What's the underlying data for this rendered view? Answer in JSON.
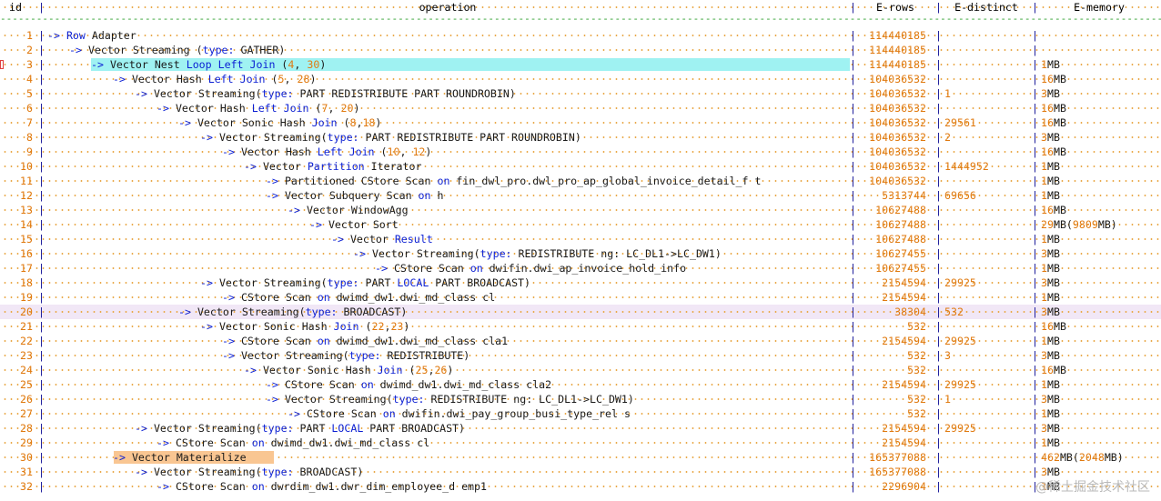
{
  "columns": {
    "id": "id",
    "operation": "operation",
    "rows": "E-rows",
    "distinct": "E-distinct",
    "memory": "E-memory"
  },
  "rows": [
    {
      "id": "1",
      "indent": 0,
      "parts": [
        [
          "arrow",
          "-> "
        ],
        [
          "kw",
          "Row"
        ],
        [
          "txt",
          " Adapter"
        ]
      ],
      "rows": "114440185",
      "distinct": "",
      "memory": []
    },
    {
      "id": "2",
      "indent": 1,
      "parts": [
        [
          "arrow",
          "-> "
        ],
        [
          "txt",
          "Vector Streaming "
        ],
        [
          "txt",
          "("
        ],
        [
          "kw",
          "type:"
        ],
        [
          "txt",
          " GATHER)"
        ]
      ],
      "rows": "114440185",
      "distinct": "",
      "memory": []
    },
    {
      "id": "3",
      "indent": 2,
      "parts": [
        [
          "arrow",
          "-> "
        ],
        [
          "txt",
          "Vector Nest "
        ],
        [
          "kw",
          "Loop Left Join"
        ],
        [
          "txt",
          " ("
        ],
        [
          "num",
          "4"
        ],
        [
          "txt",
          ", "
        ],
        [
          "num",
          "30"
        ],
        [
          "txt",
          ")"
        ]
      ],
      "rows": "114440185",
      "distinct": "",
      "memory": [
        [
          "num",
          "1"
        ],
        [
          "txt",
          "MB"
        ]
      ]
    },
    {
      "id": "4",
      "indent": 3,
      "parts": [
        [
          "arrow",
          "-> "
        ],
        [
          "txt",
          "Vector Hash "
        ],
        [
          "kw",
          "Left Join"
        ],
        [
          "txt",
          " ("
        ],
        [
          "num",
          "5"
        ],
        [
          "txt",
          ", "
        ],
        [
          "num",
          "28"
        ],
        [
          "txt",
          ")"
        ]
      ],
      "rows": "104036532",
      "distinct": "",
      "memory": [
        [
          "num",
          "16"
        ],
        [
          "txt",
          "MB"
        ]
      ]
    },
    {
      "id": "5",
      "indent": 4,
      "parts": [
        [
          "arrow",
          "-> "
        ],
        [
          "txt",
          "Vector Streaming("
        ],
        [
          "kw",
          "type:"
        ],
        [
          "txt",
          " PART REDISTRIBUTE PART ROUNDROBIN)"
        ]
      ],
      "rows": "104036532",
      "distinct": "1",
      "memory": [
        [
          "num",
          "3"
        ],
        [
          "txt",
          "MB"
        ]
      ]
    },
    {
      "id": "6",
      "indent": 5,
      "parts": [
        [
          "arrow",
          "-> "
        ],
        [
          "txt",
          "Vector Hash "
        ],
        [
          "kw",
          "Left Join"
        ],
        [
          "txt",
          " ("
        ],
        [
          "num",
          "7"
        ],
        [
          "txt",
          ", "
        ],
        [
          "num",
          "20"
        ],
        [
          "txt",
          ")"
        ]
      ],
      "rows": "104036532",
      "distinct": "",
      "memory": [
        [
          "num",
          "16"
        ],
        [
          "txt",
          "MB"
        ]
      ]
    },
    {
      "id": "7",
      "indent": 6,
      "parts": [
        [
          "arrow",
          "-> "
        ],
        [
          "txt",
          "Vector Sonic Hash "
        ],
        [
          "kw",
          "Join"
        ],
        [
          "txt",
          " ("
        ],
        [
          "num",
          "8"
        ],
        [
          "txt",
          ","
        ],
        [
          "num",
          "18"
        ],
        [
          "txt",
          ")"
        ]
      ],
      "rows": "104036532",
      "distinct": "29561",
      "memory": [
        [
          "num",
          "16"
        ],
        [
          "txt",
          "MB"
        ]
      ]
    },
    {
      "id": "8",
      "indent": 7,
      "parts": [
        [
          "arrow",
          "-> "
        ],
        [
          "txt",
          "Vector Streaming("
        ],
        [
          "kw",
          "type:"
        ],
        [
          "txt",
          " PART REDISTRIBUTE PART ROUNDROBIN)"
        ]
      ],
      "rows": "104036532",
      "distinct": "2",
      "memory": [
        [
          "num",
          "3"
        ],
        [
          "txt",
          "MB"
        ]
      ]
    },
    {
      "id": "9",
      "indent": 8,
      "parts": [
        [
          "arrow",
          "-> "
        ],
        [
          "txt",
          "Vector Hash "
        ],
        [
          "kw",
          "Left Join"
        ],
        [
          "txt",
          " ("
        ],
        [
          "num",
          "10"
        ],
        [
          "txt",
          ", "
        ],
        [
          "num",
          "12"
        ],
        [
          "txt",
          ")"
        ]
      ],
      "rows": "104036532",
      "distinct": "",
      "memory": [
        [
          "num",
          "16"
        ],
        [
          "txt",
          "MB"
        ]
      ]
    },
    {
      "id": "10",
      "indent": 9,
      "parts": [
        [
          "arrow",
          "-> "
        ],
        [
          "txt",
          "Vector "
        ],
        [
          "kw",
          "Partition"
        ],
        [
          "txt",
          " Iterator"
        ]
      ],
      "rows": "104036532",
      "distinct": "1444952",
      "memory": [
        [
          "num",
          "1"
        ],
        [
          "txt",
          "MB"
        ]
      ]
    },
    {
      "id": "11",
      "indent": 10,
      "parts": [
        [
          "arrow",
          "-> "
        ],
        [
          "txt",
          "Partitioned CStore Scan "
        ],
        [
          "kw",
          "on"
        ],
        [
          "txt",
          " fin_dwl_pro.dwl_pro_ap_global_invoice_detail_f t"
        ]
      ],
      "rows": "104036532",
      "distinct": "",
      "memory": [
        [
          "num",
          "1"
        ],
        [
          "txt",
          "MB"
        ]
      ]
    },
    {
      "id": "12",
      "indent": 10,
      "parts": [
        [
          "arrow",
          "-> "
        ],
        [
          "txt",
          "Vector Subquery Scan "
        ],
        [
          "kw",
          "on"
        ],
        [
          "txt",
          " h"
        ]
      ],
      "rows": "5313744",
      "distinct": "69656",
      "memory": [
        [
          "num",
          "1"
        ],
        [
          "txt",
          "MB"
        ]
      ]
    },
    {
      "id": "13",
      "indent": 11,
      "parts": [
        [
          "arrow",
          "-> "
        ],
        [
          "txt",
          "Vector WindowAgg"
        ]
      ],
      "rows": "10627488",
      "distinct": "",
      "memory": [
        [
          "num",
          "16"
        ],
        [
          "txt",
          "MB"
        ]
      ]
    },
    {
      "id": "14",
      "indent": 12,
      "parts": [
        [
          "arrow",
          "-> "
        ],
        [
          "txt",
          "Vector Sort"
        ]
      ],
      "rows": "10627488",
      "distinct": "",
      "memory": [
        [
          "num",
          "29"
        ],
        [
          "txt",
          "MB("
        ],
        [
          "num",
          "9809"
        ],
        [
          "txt",
          "MB)"
        ]
      ]
    },
    {
      "id": "15",
      "indent": 13,
      "parts": [
        [
          "arrow",
          "-> "
        ],
        [
          "txt",
          "Vector "
        ],
        [
          "kw",
          "Result"
        ]
      ],
      "rows": "10627488",
      "distinct": "",
      "memory": [
        [
          "num",
          "1"
        ],
        [
          "txt",
          "MB"
        ]
      ]
    },
    {
      "id": "16",
      "indent": 14,
      "parts": [
        [
          "arrow",
          "-> "
        ],
        [
          "txt",
          "Vector Streaming("
        ],
        [
          "kw",
          "type:"
        ],
        [
          "txt",
          " REDISTRIBUTE ng: LC_DL1->LC_DW1)"
        ]
      ],
      "rows": "10627455",
      "distinct": "",
      "memory": [
        [
          "num",
          "3"
        ],
        [
          "txt",
          "MB"
        ]
      ]
    },
    {
      "id": "17",
      "indent": 15,
      "parts": [
        [
          "arrow",
          "-> "
        ],
        [
          "txt",
          "CStore Scan "
        ],
        [
          "kw",
          "on"
        ],
        [
          "txt",
          " dwifin.dwi_ap_invoice_hold_info"
        ]
      ],
      "rows": "10627455",
      "distinct": "",
      "memory": [
        [
          "num",
          "1"
        ],
        [
          "txt",
          "MB"
        ]
      ]
    },
    {
      "id": "18",
      "indent": 7,
      "parts": [
        [
          "arrow",
          "-> "
        ],
        [
          "txt",
          "Vector Streaming("
        ],
        [
          "kw",
          "type:"
        ],
        [
          "txt",
          " PART "
        ],
        [
          "kw",
          "LOCAL"
        ],
        [
          "txt",
          " PART BROADCAST)"
        ]
      ],
      "rows": "2154594",
      "distinct": "29925",
      "memory": [
        [
          "num",
          "3"
        ],
        [
          "txt",
          "MB"
        ]
      ]
    },
    {
      "id": "19",
      "indent": 8,
      "parts": [
        [
          "arrow",
          "-> "
        ],
        [
          "txt",
          "CStore Scan "
        ],
        [
          "kw",
          "on"
        ],
        [
          "txt",
          " dwimd_dw1.dwi_md_class cl"
        ]
      ],
      "rows": "2154594",
      "distinct": "",
      "memory": [
        [
          "num",
          "1"
        ],
        [
          "txt",
          "MB"
        ]
      ]
    },
    {
      "id": "20",
      "indent": 6,
      "parts": [
        [
          "arrow",
          "-> "
        ],
        [
          "txt",
          "Vector Streaming("
        ],
        [
          "kw",
          "type:"
        ],
        [
          "txt",
          " BROADCAST)"
        ]
      ],
      "rows": "38304",
      "distinct": "532",
      "memory": [
        [
          "num",
          "3"
        ],
        [
          "txt",
          "MB"
        ]
      ]
    },
    {
      "id": "21",
      "indent": 7,
      "parts": [
        [
          "arrow",
          "-> "
        ],
        [
          "txt",
          "Vector Sonic Hash "
        ],
        [
          "kw",
          "Join"
        ],
        [
          "txt",
          " ("
        ],
        [
          "num",
          "22"
        ],
        [
          "txt",
          ","
        ],
        [
          "num",
          "23"
        ],
        [
          "txt",
          ")"
        ]
      ],
      "rows": "532",
      "distinct": "",
      "memory": [
        [
          "num",
          "16"
        ],
        [
          "txt",
          "MB"
        ]
      ]
    },
    {
      "id": "22",
      "indent": 8,
      "parts": [
        [
          "arrow",
          "-> "
        ],
        [
          "txt",
          "CStore Scan "
        ],
        [
          "kw",
          "on"
        ],
        [
          "txt",
          " dwimd_dw1.dwi_md_class cla1"
        ]
      ],
      "rows": "2154594",
      "distinct": "29925",
      "memory": [
        [
          "num",
          "1"
        ],
        [
          "txt",
          "MB"
        ]
      ]
    },
    {
      "id": "23",
      "indent": 8,
      "parts": [
        [
          "arrow",
          "-> "
        ],
        [
          "txt",
          "Vector Streaming("
        ],
        [
          "kw",
          "type:"
        ],
        [
          "txt",
          " REDISTRIBUTE)"
        ]
      ],
      "rows": "532",
      "distinct": "3",
      "memory": [
        [
          "num",
          "3"
        ],
        [
          "txt",
          "MB"
        ]
      ]
    },
    {
      "id": "24",
      "indent": 9,
      "parts": [
        [
          "arrow",
          "-> "
        ],
        [
          "txt",
          "Vector Sonic Hash "
        ],
        [
          "kw",
          "Join"
        ],
        [
          "txt",
          " ("
        ],
        [
          "num",
          "25"
        ],
        [
          "txt",
          ","
        ],
        [
          "num",
          "26"
        ],
        [
          "txt",
          ")"
        ]
      ],
      "rows": "532",
      "distinct": "",
      "memory": [
        [
          "num",
          "16"
        ],
        [
          "txt",
          "MB"
        ]
      ]
    },
    {
      "id": "25",
      "indent": 10,
      "parts": [
        [
          "arrow",
          "-> "
        ],
        [
          "txt",
          "CStore Scan "
        ],
        [
          "kw",
          "on"
        ],
        [
          "txt",
          " dwimd_dw1.dwi_md_class cla2"
        ]
      ],
      "rows": "2154594",
      "distinct": "29925",
      "memory": [
        [
          "num",
          "1"
        ],
        [
          "txt",
          "MB"
        ]
      ]
    },
    {
      "id": "26",
      "indent": 10,
      "parts": [
        [
          "arrow",
          "-> "
        ],
        [
          "txt",
          "Vector Streaming("
        ],
        [
          "kw",
          "type:"
        ],
        [
          "txt",
          " REDISTRIBUTE ng: LC_DL1->LC_DW1)"
        ]
      ],
      "rows": "532",
      "distinct": "1",
      "memory": [
        [
          "num",
          "3"
        ],
        [
          "txt",
          "MB"
        ]
      ]
    },
    {
      "id": "27",
      "indent": 11,
      "parts": [
        [
          "arrow",
          "-> "
        ],
        [
          "txt",
          "CStore Scan "
        ],
        [
          "kw",
          "on"
        ],
        [
          "txt",
          " dwifin.dwi_pay_group_busi_type_rel s"
        ]
      ],
      "rows": "532",
      "distinct": "",
      "memory": [
        [
          "num",
          "1"
        ],
        [
          "txt",
          "MB"
        ]
      ]
    },
    {
      "id": "28",
      "indent": 4,
      "parts": [
        [
          "arrow",
          "-> "
        ],
        [
          "txt",
          "Vector Streaming("
        ],
        [
          "kw",
          "type:"
        ],
        [
          "txt",
          " PART "
        ],
        [
          "kw",
          "LOCAL"
        ],
        [
          "txt",
          " PART BROADCAST)"
        ]
      ],
      "rows": "2154594",
      "distinct": "29925",
      "memory": [
        [
          "num",
          "3"
        ],
        [
          "txt",
          "MB"
        ]
      ]
    },
    {
      "id": "29",
      "indent": 5,
      "parts": [
        [
          "arrow",
          "-> "
        ],
        [
          "txt",
          "CStore Scan "
        ],
        [
          "kw",
          "on"
        ],
        [
          "txt",
          " dwimd_dw1.dwi_md_class cl"
        ]
      ],
      "rows": "2154594",
      "distinct": "",
      "memory": [
        [
          "num",
          "1"
        ],
        [
          "txt",
          "MB"
        ]
      ]
    },
    {
      "id": "30",
      "indent": 3,
      "parts": [
        [
          "arrow",
          "-> "
        ],
        [
          "txt",
          "Vector Materialize"
        ]
      ],
      "rows": "165377088",
      "distinct": "",
      "memory": [
        [
          "num",
          "462"
        ],
        [
          "txt",
          "MB("
        ],
        [
          "num",
          "2048"
        ],
        [
          "txt",
          "MB)"
        ]
      ]
    },
    {
      "id": "31",
      "indent": 4,
      "parts": [
        [
          "arrow",
          "-> "
        ],
        [
          "txt",
          "Vector Streaming("
        ],
        [
          "kw",
          "type:"
        ],
        [
          "txt",
          " BROADCAST)"
        ]
      ],
      "rows": "165377088",
      "distinct": "",
      "memory": [
        [
          "num",
          "3"
        ],
        [
          "txt",
          "MB"
        ]
      ]
    },
    {
      "id": "32",
      "indent": 5,
      "parts": [
        [
          "arrow",
          "-> "
        ],
        [
          "txt",
          "CStore Scan "
        ],
        [
          "kw",
          "on"
        ],
        [
          "txt",
          " dwrdim_dw1.dwr_dim_employee_d emp1"
        ]
      ],
      "rows": "2296904",
      "distinct": "",
      "memory": [
        [
          "num",
          "1"
        ],
        [
          "txt",
          "MB"
        ]
      ]
    }
  ],
  "watermark": "@稀土掘金技术社区",
  "highlights": {
    "row_3": "#9ff2f2",
    "row_20": "#f1e7f6",
    "row_30": "#f9c692"
  }
}
